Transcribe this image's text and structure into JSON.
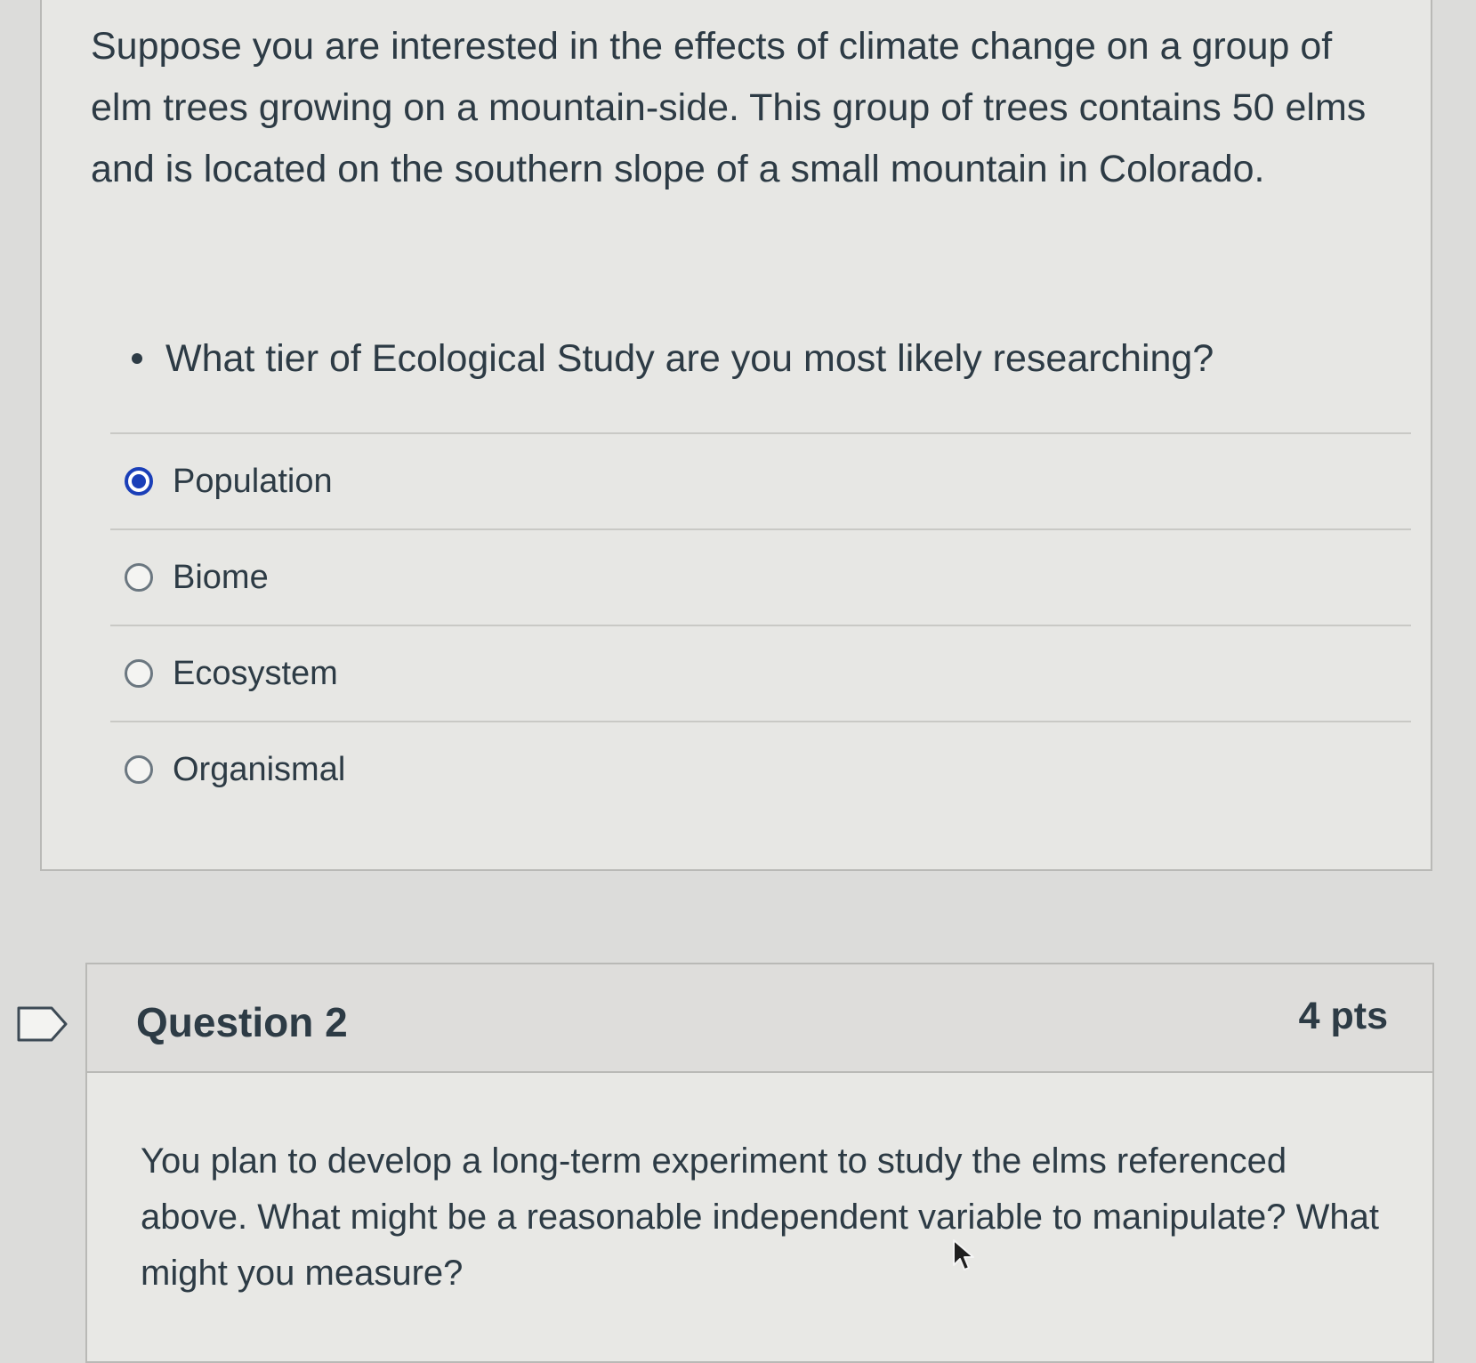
{
  "question1": {
    "scenario": "Suppose you are interested in the effects of climate change on a group of elm trees growing on a mountain-side.  This group of trees contains 50 elms and is located on the southern slope of a small mountain in Colorado.",
    "prompt": "What tier of Ecological Study are you most likely researching?",
    "answers": [
      {
        "label": "Population",
        "selected": true
      },
      {
        "label": "Biome",
        "selected": false
      },
      {
        "label": "Ecosystem",
        "selected": false
      },
      {
        "label": "Organismal",
        "selected": false
      }
    ]
  },
  "question2": {
    "title": "Question 2",
    "points": "4 pts",
    "body": "You plan to develop a long-term experiment to study the elms referenced above.  What might be a reasonable independent variable to manipulate? What might you measure?"
  },
  "icons": {
    "flag": "flag-question-icon",
    "cursor": "mouse-pointer-icon"
  },
  "colors": {
    "selected_radio": "#1a3fb8",
    "text": "#2d3b45"
  }
}
